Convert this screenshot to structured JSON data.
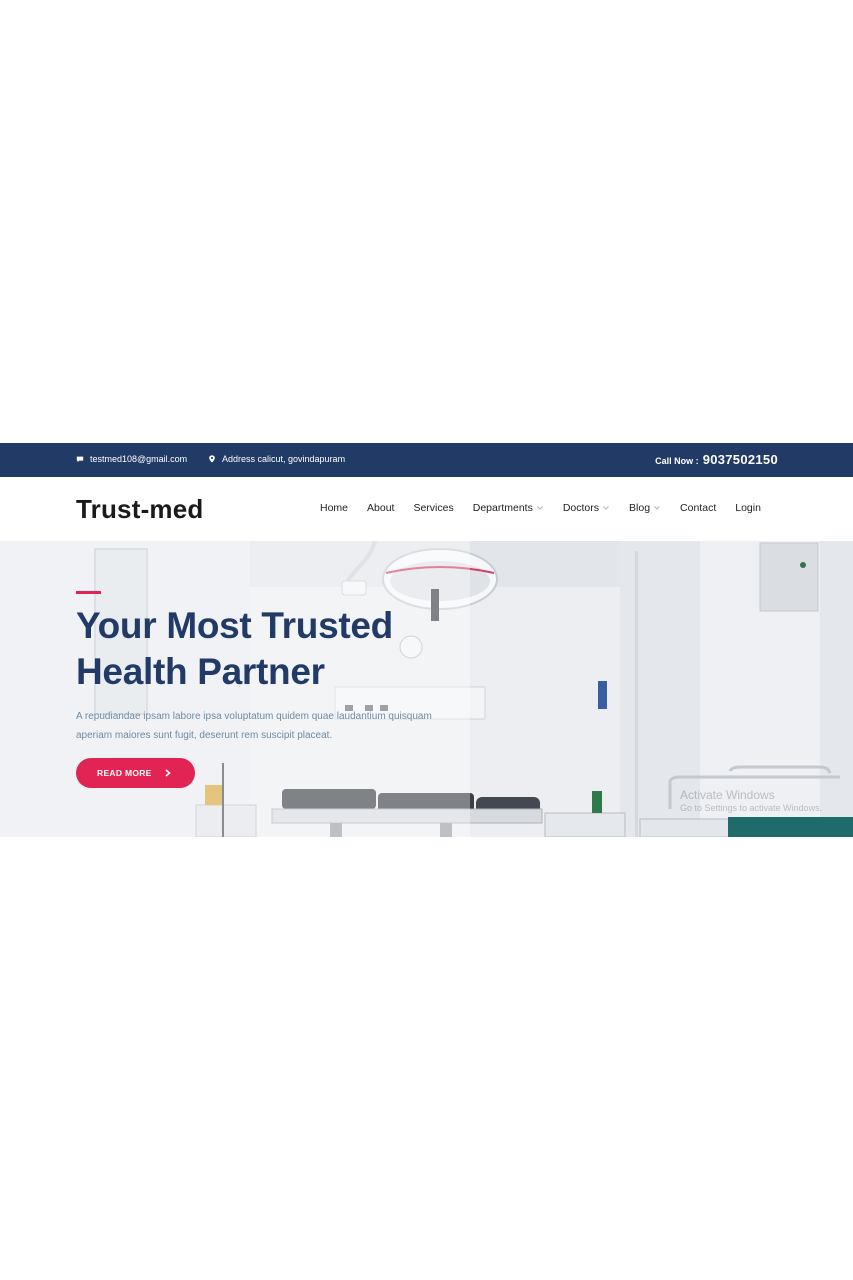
{
  "topbar": {
    "email": "testmed108@gmail.com",
    "address": "Address calicut, govindapuram",
    "call_label": "Call Now :",
    "phone": "9037502150"
  },
  "brand": {
    "name": "Trust-med"
  },
  "nav": {
    "items": [
      {
        "label": "Home",
        "dropdown": false
      },
      {
        "label": "About",
        "dropdown": false
      },
      {
        "label": "Services",
        "dropdown": false
      },
      {
        "label": "Departments",
        "dropdown": true
      },
      {
        "label": "Doctors",
        "dropdown": true
      },
      {
        "label": "Blog",
        "dropdown": true
      },
      {
        "label": "Contact",
        "dropdown": false
      },
      {
        "label": "Login",
        "dropdown": false
      }
    ]
  },
  "hero": {
    "title_line1": "Your Most Trusted",
    "title_line2": "Health Partner",
    "description": "A repudiandae ipsam labore ipsa voluptatum quidem quae laudantium quisquam aperiam maiores sunt fugit, deserunt rem suscipit placeat.",
    "button_label": "READ MORE"
  },
  "watermark": {
    "line1": "Activate Windows",
    "line2": "Go to Settings to activate Windows."
  },
  "colors": {
    "primary": "#223a66",
    "accent": "#e12454",
    "muted_text": "#6f8ba4"
  },
  "icons": {
    "email": "chat-icon",
    "address": "map-pin-icon",
    "dropdown": "chevron-down-icon",
    "button": "chevron-right-icon"
  }
}
